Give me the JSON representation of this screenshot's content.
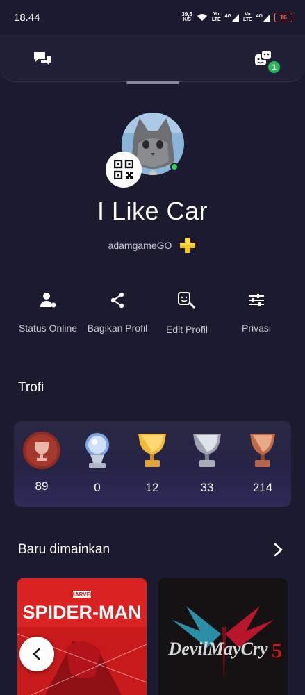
{
  "status_bar": {
    "time": "18.44",
    "net_speed_value": "39,5",
    "net_speed_unit": "K/S",
    "sim1_label_top": "Vo",
    "sim1_label_bottom": "LTE",
    "sim1_gen": "4G",
    "sim2_label_top": "Vo",
    "sim2_label_bottom": "LTE",
    "sim2_gen": "4G",
    "battery": "16"
  },
  "top_bar": {
    "chat_badge": "1"
  },
  "profile": {
    "display_name": "I Like Car",
    "username": "adamgameGO"
  },
  "actions": [
    {
      "label": "Status Online",
      "icon": "person-status-icon"
    },
    {
      "label": "Bagikan Profil",
      "icon": "share-icon"
    },
    {
      "label": "Edit Profil",
      "icon": "edit-profile-icon"
    },
    {
      "label": "Privasi",
      "icon": "sliders-icon"
    }
  ],
  "trophies": {
    "title": "Trofi",
    "items": [
      {
        "type": "level",
        "count": "89"
      },
      {
        "type": "platinum",
        "count": "0"
      },
      {
        "type": "gold",
        "count": "12"
      },
      {
        "type": "silver",
        "count": "33"
      },
      {
        "type": "bronze",
        "count": "214"
      }
    ]
  },
  "recent": {
    "title": "Baru dimainkan",
    "games": [
      {
        "brand": "MARVEL",
        "title": "SPIDER-MAN"
      },
      {
        "title": "DevilMayCry",
        "numeral": "5"
      }
    ]
  },
  "colors": {
    "background": "#1c1a2e",
    "online": "#2bd45a",
    "ps_plus": "#f5c518",
    "badge": "#2bb55a"
  }
}
